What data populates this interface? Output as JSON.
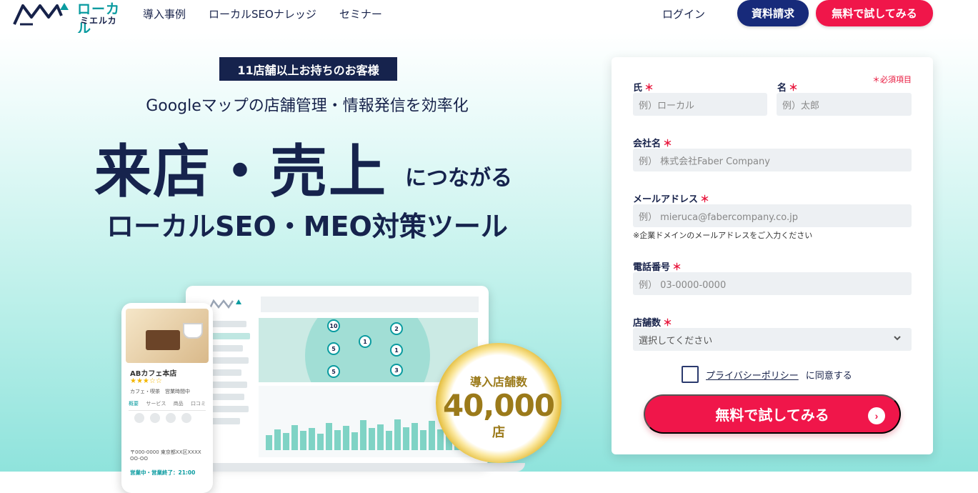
{
  "header": {
    "logo_line1": "ローカル",
    "logo_line2": "ミエルカ",
    "nav": [
      "導入事例",
      "ローカルSEOナレッジ",
      "セミナー"
    ],
    "login": "ログイン",
    "doc_button": "資料請求",
    "try_button": "無料で試してみる"
  },
  "hero": {
    "badge": "11店舗以上お持ちのお客様",
    "subheadline": "Googleマップの店舗管理・情報発信を効率化",
    "headline": "来店・売上",
    "headline_suffix": "につながる",
    "tagline": "ローカルSEO・MEO対策ツール"
  },
  "mockup": {
    "shop_name": "ABカフェ本店",
    "stars": "★★★☆☆",
    "category": "カフェ・喫茶　営業時間中",
    "tabs": [
      "概要",
      "サービス",
      "商品",
      "口コミ"
    ],
    "address": "〒000-0000 東京都XX区XXXX OO-OO",
    "hours": "営業中・営業終了：21:00",
    "pins": [
      "10",
      "5",
      "1",
      "2",
      "1",
      "5",
      "3"
    ]
  },
  "medal": {
    "label": "導入店舗数",
    "number": "40,000",
    "unit": "店"
  },
  "form": {
    "required_note": "＊必須項目",
    "last_name_label": "氏",
    "last_name_placeholder": "例）ローカル",
    "first_name_label": "名",
    "first_name_placeholder": "例）太郎",
    "company_label": "会社名",
    "company_placeholder": "例） 株式会社Faber Company",
    "email_label": "メールアドレス",
    "email_placeholder": "例） mieruca@fabercompany.co.jp",
    "email_hint": "※企業ドメインのメールアドレスをご入力ください",
    "phone_label": "電話番号",
    "phone_placeholder": "例） 03-0000-0000",
    "stores_label": "店舗数",
    "stores_selected": "選択してください",
    "required_mark": "＊",
    "privacy_link": "プライバシーポリシー",
    "privacy_suffix": "に同意する",
    "submit_label": "無料で試してみる"
  },
  "colors": {
    "navy": "#16234d",
    "accent_red": "#f0164a",
    "teal": "#0a9ba0",
    "doc_button_bg": "#172a7a"
  }
}
